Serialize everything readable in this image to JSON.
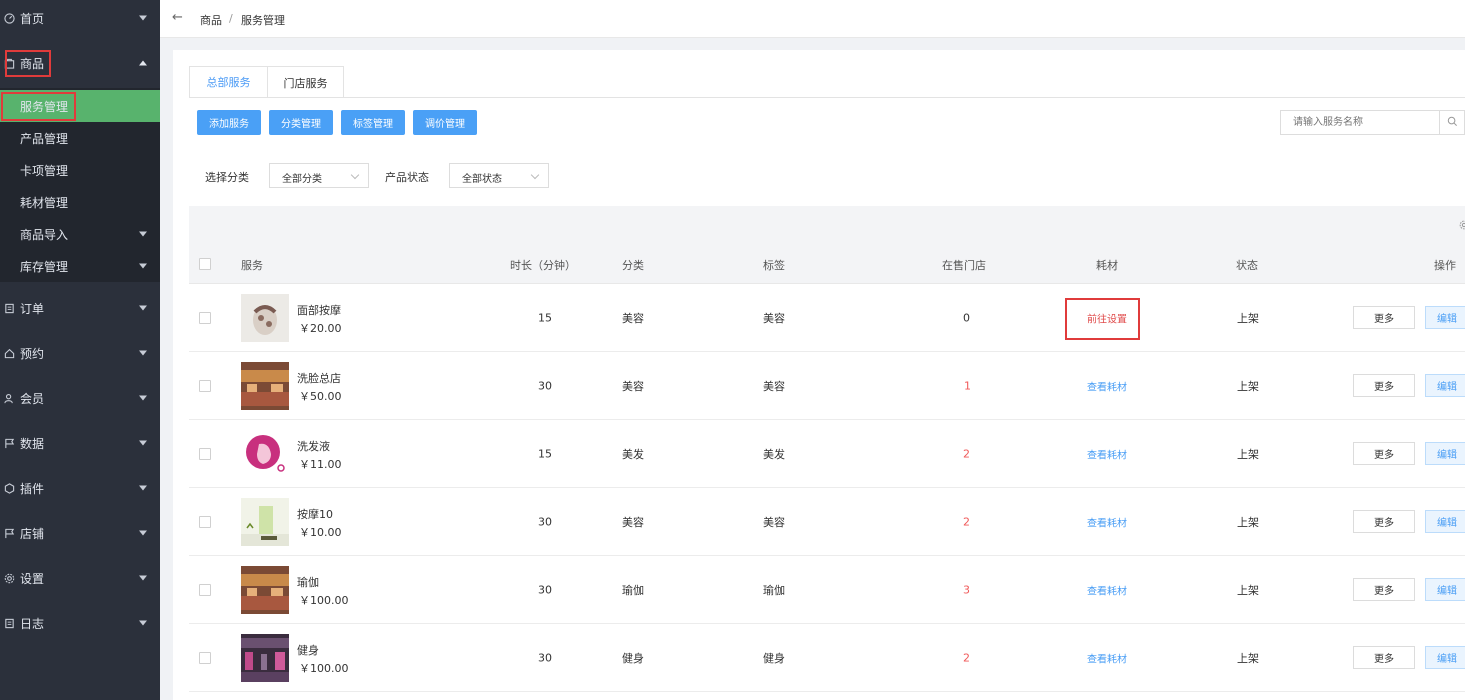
{
  "sidebar": {
    "items": [
      {
        "label": "首页",
        "icon": "dashboard-icon"
      },
      {
        "label": "商品",
        "icon": "goods-icon"
      },
      {
        "label": "订单",
        "icon": "order-icon"
      },
      {
        "label": "预约",
        "icon": "home-icon"
      },
      {
        "label": "会员",
        "icon": "member-icon"
      },
      {
        "label": "数据",
        "icon": "flag-icon"
      },
      {
        "label": "插件",
        "icon": "plugin-icon"
      },
      {
        "label": "店铺",
        "icon": "flag-icon"
      },
      {
        "label": "设置",
        "icon": "gear-icon"
      },
      {
        "label": "日志",
        "icon": "log-icon"
      }
    ],
    "sub_items": [
      {
        "label": "服务管理"
      },
      {
        "label": "产品管理"
      },
      {
        "label": "卡项管理"
      },
      {
        "label": "耗材管理"
      },
      {
        "label": "商品导入"
      },
      {
        "label": "库存管理"
      }
    ],
    "active_color": "#58b36d"
  },
  "breadcrumb": {
    "level1": "商品",
    "sep": "/",
    "level2": "服务管理"
  },
  "tabs": [
    "总部服务",
    "门店服务"
  ],
  "toolbar": {
    "add_label": "添加服务",
    "category_label": "分类管理",
    "tag_label": "标签管理",
    "price_label": "调价管理"
  },
  "search": {
    "placeholder": "请输入服务名称"
  },
  "filters": {
    "category_label": "选择分类",
    "category_value": "全部分类",
    "status_label": "产品状态",
    "status_value": "全部状态"
  },
  "table": {
    "headers": [
      "服务",
      "时长（分钟）",
      "分类",
      "标签",
      "在售门店",
      "耗材",
      "状态",
      "操作"
    ],
    "rows": [
      {
        "name": "面部按摩",
        "price": "￥20.00",
        "duration": "15",
        "category": "美容",
        "tag": "美容",
        "stores": "0",
        "consumable": "前往设置",
        "status": "上架",
        "more": "更多",
        "edit": "编辑"
      },
      {
        "name": "洗脸总店",
        "price": "￥50.00",
        "duration": "30",
        "category": "美容",
        "tag": "美容",
        "stores": "1",
        "consumable": "查看耗材",
        "status": "上架",
        "more": "更多",
        "edit": "编辑"
      },
      {
        "name": "洗发液",
        "price": "￥11.00",
        "duration": "15",
        "category": "美发",
        "tag": "美发",
        "stores": "2",
        "consumable": "查看耗材",
        "status": "上架",
        "more": "更多",
        "edit": "编辑"
      },
      {
        "name": "按摩10",
        "price": "￥10.00",
        "duration": "30",
        "category": "美容",
        "tag": "美容",
        "stores": "2",
        "consumable": "查看耗材",
        "status": "上架",
        "more": "更多",
        "edit": "编辑"
      },
      {
        "name": "瑜伽",
        "price": "￥100.00",
        "duration": "30",
        "category": "瑜伽",
        "tag": "瑜伽",
        "stores": "3",
        "consumable": "查看耗材",
        "status": "上架",
        "more": "更多",
        "edit": "编辑"
      },
      {
        "name": "健身",
        "price": "￥100.00",
        "duration": "30",
        "category": "健身",
        "tag": "健身",
        "stores": "2",
        "consumable": "查看耗材",
        "status": "上架",
        "more": "更多",
        "edit": "编辑"
      }
    ]
  },
  "colors": {
    "sidebar_bg": "#2b303b",
    "primary_blue": "#4aa0f6",
    "highlight_red": "#e03b3b",
    "store_count_red": "#f05a5a"
  }
}
